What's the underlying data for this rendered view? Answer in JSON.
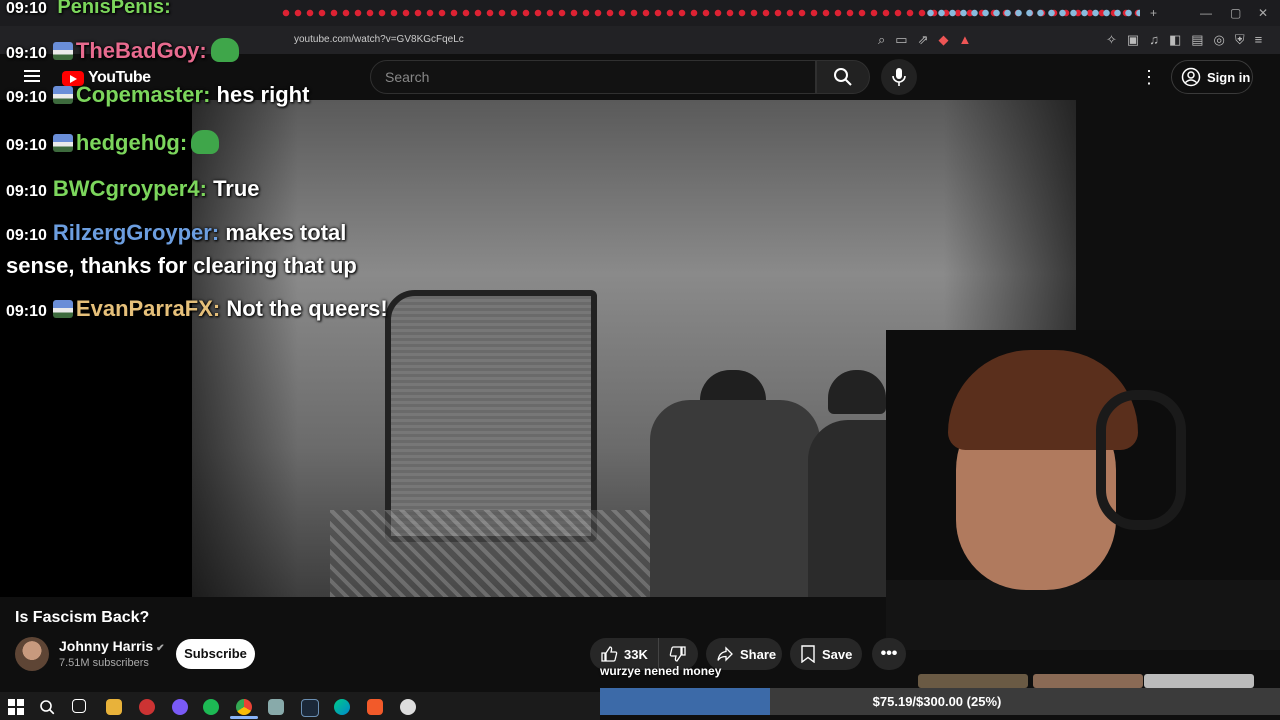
{
  "browser": {
    "top_tab_text": "PenisPenis:",
    "top_time": "09:10",
    "url": "youtube.com/watch?v=GV8KGcFqeLc"
  },
  "youtube": {
    "logo_text": "YouTube",
    "search_placeholder": "Search",
    "sign_in": "Sign in"
  },
  "chat": [
    {
      "time": "09:10",
      "user": "TheBadGoy",
      "color": "#e86b8f",
      "message": "",
      "emote": "frog"
    },
    {
      "time": "09:10",
      "user": "Copemaster",
      "color": "#7cd65c",
      "message": "hes right"
    },
    {
      "time": "09:10",
      "user": "hedgeh0g",
      "color": "#7cd65c",
      "message": "",
      "emote": "frog"
    },
    {
      "time": "09:10",
      "user": "BWCgroyper4",
      "color": "#7cd65c",
      "message": "True"
    },
    {
      "time": "09:10",
      "user": "RilzergGroyper",
      "color": "#6c9ee0",
      "message": "makes total",
      "continuation": "sense, thanks for clearing that up"
    },
    {
      "time": "09:10",
      "user": "EvanParraFX",
      "color": "#e6c07a",
      "message": "Not the queers!"
    }
  ],
  "video": {
    "title": "Is Fascism Back?",
    "channel": "Johnny Harris",
    "subscribers": "7.51M subscribers",
    "subscribe_label": "Subscribe",
    "likes": "33K",
    "share_label": "Share",
    "save_label": "Save"
  },
  "overlay": {
    "donation_caption": "wurzye nened money",
    "goal_text": "$75.19/$300.00 (25%)",
    "goal_fraction": 0.25
  }
}
